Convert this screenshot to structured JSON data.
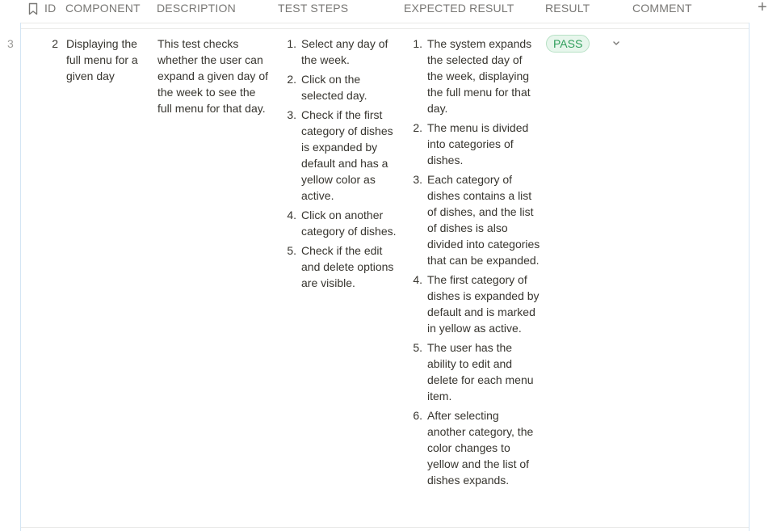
{
  "header": {
    "id_label": "ID",
    "component_label": "COMPONENT",
    "description_label": "DESCRIPTION",
    "test_steps_label": "TEST STEPS",
    "expected_label": "EXPECTED RESULT",
    "result_label": "RESULT",
    "comment_label": "COMMENT",
    "add_icon": "plus-icon",
    "bookmark_icon": "bookmark-icon"
  },
  "row": {
    "row_number": "3",
    "id": "2",
    "component": "Displaying the full menu for a given day",
    "description": "This test checks whether the user can expand a given day of the week to see the full menu for that day.",
    "test_steps": [
      {
        "num": "1.",
        "text": "Select any day of the week."
      },
      {
        "num": "2.",
        "text": "Click on the selected day."
      },
      {
        "num": "3.",
        "text": "Check if the first category of dishes is expanded by default and has a yellow color as active."
      },
      {
        "num": "4.",
        "text": "Click on another category of dishes."
      },
      {
        "num": "5.",
        "text": "Check if the edit and delete options are visible."
      }
    ],
    "expected_results": [
      {
        "num": "1.",
        "text": "The system expands the selected day of the week, displaying the full menu for that day."
      },
      {
        "num": "2.",
        "text": "The menu is divided into categories of dishes."
      },
      {
        "num": "3.",
        "text": "Each category of dishes contains a list of dishes, and the list of dishes is also divided into categories that can be expanded."
      },
      {
        "num": "4.",
        "text": "The first category of dishes is expanded by default and is marked in yellow as active."
      },
      {
        "num": "5.",
        "text": "The user has the ability to edit and delete for each menu item."
      },
      {
        "num": "6.",
        "text": "After selecting another category, the color changes to yellow and the list of dishes expands."
      }
    ],
    "result": "PASS",
    "comment": ""
  },
  "colors": {
    "pass_text": "#2f9e5b",
    "pass_bg": "#e7f6ec",
    "pass_border": "#b7e1c5",
    "header_text": "#787774",
    "border_blue": "#d4e5f4"
  }
}
